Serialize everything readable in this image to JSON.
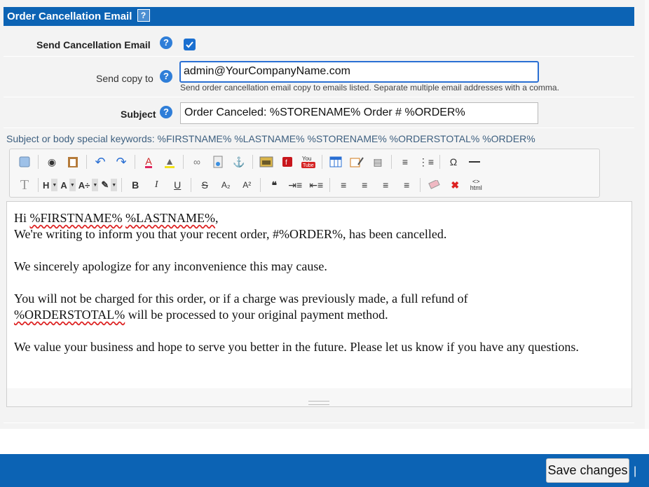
{
  "section": {
    "title": "Order Cancellation Email",
    "help_glyph": "?"
  },
  "send_email": {
    "label": "Send Cancellation Email",
    "checked": true
  },
  "send_copy": {
    "label": "Send copy to",
    "value": "admin@YourCompanyName.com",
    "hint": "Send order cancellation email copy to emails listed. Separate multiple email addresses with a comma."
  },
  "subject": {
    "label": "Subject",
    "value": "Order Canceled: %STORENAME% Order # %ORDER%"
  },
  "keywords_text": "Subject or body special keywords: %FIRSTNAME% %LASTNAME% %STORENAME% %ORDERSTOTAL% %ORDER%",
  "toolbar": {
    "row1": [
      "source",
      "find",
      "paste",
      "undo",
      "redo",
      "text-color",
      "bg-color",
      "link",
      "document",
      "anchor",
      "image",
      "flash",
      "youtube",
      "table",
      "table-edit",
      "page-break",
      "numbered-list",
      "bulleted-list",
      "special-char",
      "horizontal-rule"
    ],
    "heading_label": "H",
    "font_label": "A",
    "size_label": "A÷",
    "omega": "Ω",
    "bold": "B",
    "italic": "I",
    "underline": "U",
    "strike": "S",
    "subscript": "A₂",
    "superscript": "A²",
    "quote": "❝",
    "html_label": "html"
  },
  "editor": {
    "line1_prefix": "Hi ",
    "firstname": "%FIRSTNAME%",
    "line1_mid": " ",
    "lastname": "%LASTNAME%",
    "line1_suffix": ",",
    "line2": "We're writing to inform you that your recent order, #%ORDER%, has been cancelled.",
    "para2": "We sincerely apologize for any inconvenience this may cause.",
    "para3_line1": "You will not be charged for this order, or if a charge was previously made, a full refund of",
    "orderstotal": "%ORDERSTOTAL%",
    "para3_line2_suffix": " will be processed to your original payment method.",
    "para4": "We value your business and hope to serve you better in the future. Please let us know if you have any questions."
  },
  "footer": {
    "save_label": "Save changes",
    "pipe": "|"
  },
  "colors": {
    "header_blue": "#0c63b4",
    "accent": "#2f7ed8"
  }
}
